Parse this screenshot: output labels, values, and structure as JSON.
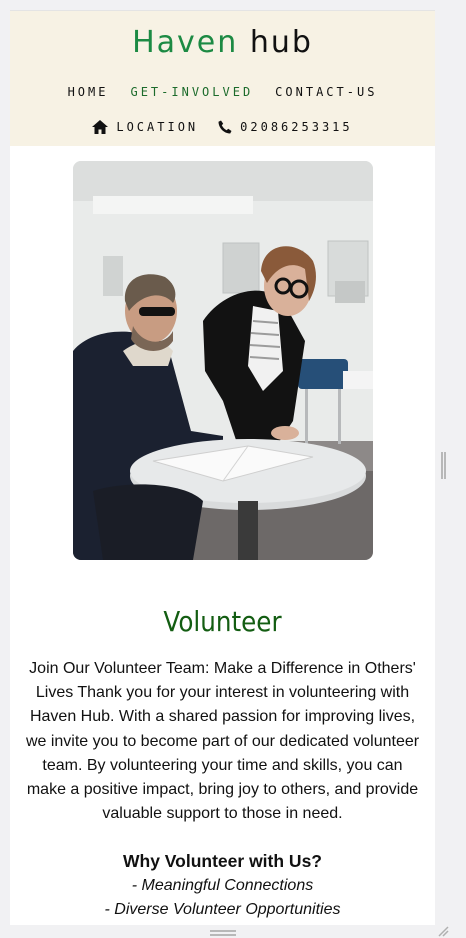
{
  "header": {
    "brand_part1": "Haven",
    "brand_part2": "hub",
    "nav": [
      "HOME",
      "GET-INVOLVED",
      "CONTACT-US"
    ],
    "active_nav": "GET-INVOLVED",
    "location_label": "LOCATION",
    "phone": "02086253315",
    "location_icon": "home-icon",
    "phone_icon": "phone-icon"
  },
  "hero": {
    "image": "volunteer-photo"
  },
  "content": {
    "title": "Volunteer",
    "body": "Join Our Volunteer Team: Make a Difference in Others' Lives Thank you for your interest in volunteering with Haven Hub. With a shared passion for improving lives, we invite you to become part of our dedicated volunteer team. By volunteering your time and skills, you can make a positive impact, bring joy to others, and provide valuable support to those in need.",
    "subheading": "Why Volunteer with Us?",
    "reasons": [
      "- Meaningful Connections",
      "- Diverse Volunteer Opportunities"
    ]
  },
  "colors": {
    "brand_green": "#1c8a43",
    "title_green": "#135d12",
    "header_bg": "#f7f2e4"
  }
}
